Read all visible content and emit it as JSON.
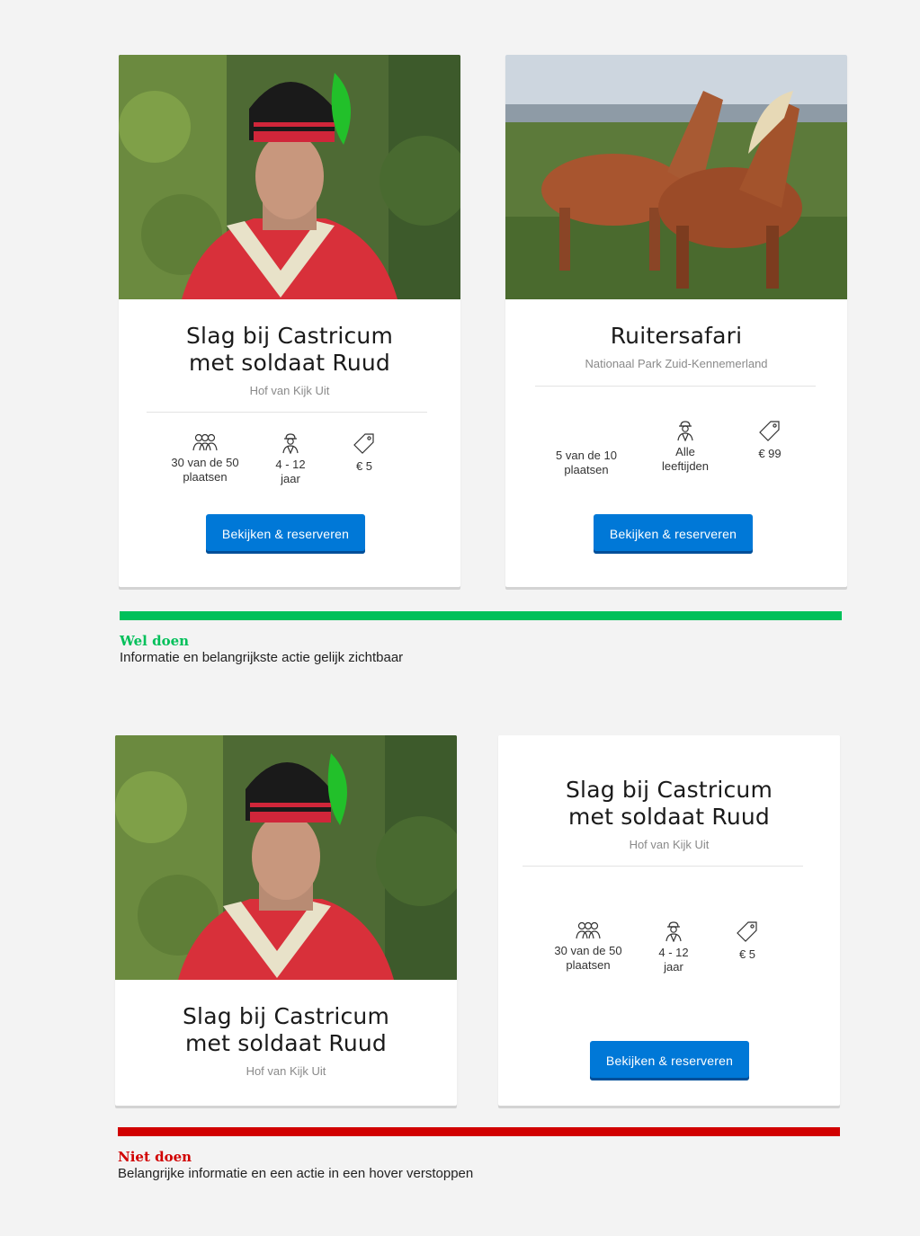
{
  "cards": {
    "soldier_good": {
      "title_line1": "Slag bij Castricum",
      "title_line2": "met soldaat Ruud",
      "subtitle": "Hof van Kijk Uit",
      "stats": [
        {
          "icon": "group-icon",
          "line1": "30 van de 50",
          "line2": "plaatsen"
        },
        {
          "icon": "child-icon",
          "line1": "4 - 12",
          "line2": "jaar"
        },
        {
          "icon": "price-tag-icon",
          "line1": "€ 5",
          "line2": ""
        }
      ],
      "button_label": "Bekijken & reserveren"
    },
    "horse_good": {
      "title": "Ruitersafari",
      "subtitle": "Nationaal Park Zuid-Kennemerland",
      "stats": [
        {
          "icon": "",
          "line1": "5 van de 10",
          "line2": "plaatsen"
        },
        {
          "icon": "child-icon",
          "line1": "Alle",
          "line2": "leeftijden"
        },
        {
          "icon": "price-tag-icon",
          "line1": "€ 99",
          "line2": ""
        }
      ],
      "button_label": "Bekijken & reserveren"
    },
    "soldier_bad_front": {
      "title_line1": "Slag bij Castricum",
      "title_line2": "met soldaat Ruud",
      "subtitle": "Hof van Kijk Uit"
    },
    "soldier_bad_hover": {
      "title_line1": "Slag bij Castricum",
      "title_line2": "met soldaat Ruud",
      "subtitle": "Hof van Kijk Uit",
      "stats": [
        {
          "icon": "group-icon",
          "line1": "30 van de 50",
          "line2": "plaatsen"
        },
        {
          "icon": "child-icon",
          "line1": "4 - 12",
          "line2": "jaar"
        },
        {
          "icon": "price-tag-icon",
          "line1": "€ 5",
          "line2": ""
        }
      ],
      "button_label": "Bekijken & reserveren"
    }
  },
  "good": {
    "label": "Wel doen",
    "description": "Informatie en belangrijkste actie gelijk zichtbaar",
    "color": "#00c05a"
  },
  "bad": {
    "label": "Niet doen",
    "description": "Belangrijke informatie en een actie in een hover verstoppen",
    "color": "#d10000"
  },
  "colors": {
    "button": "#0078d7",
    "background": "#f3f3f3"
  }
}
